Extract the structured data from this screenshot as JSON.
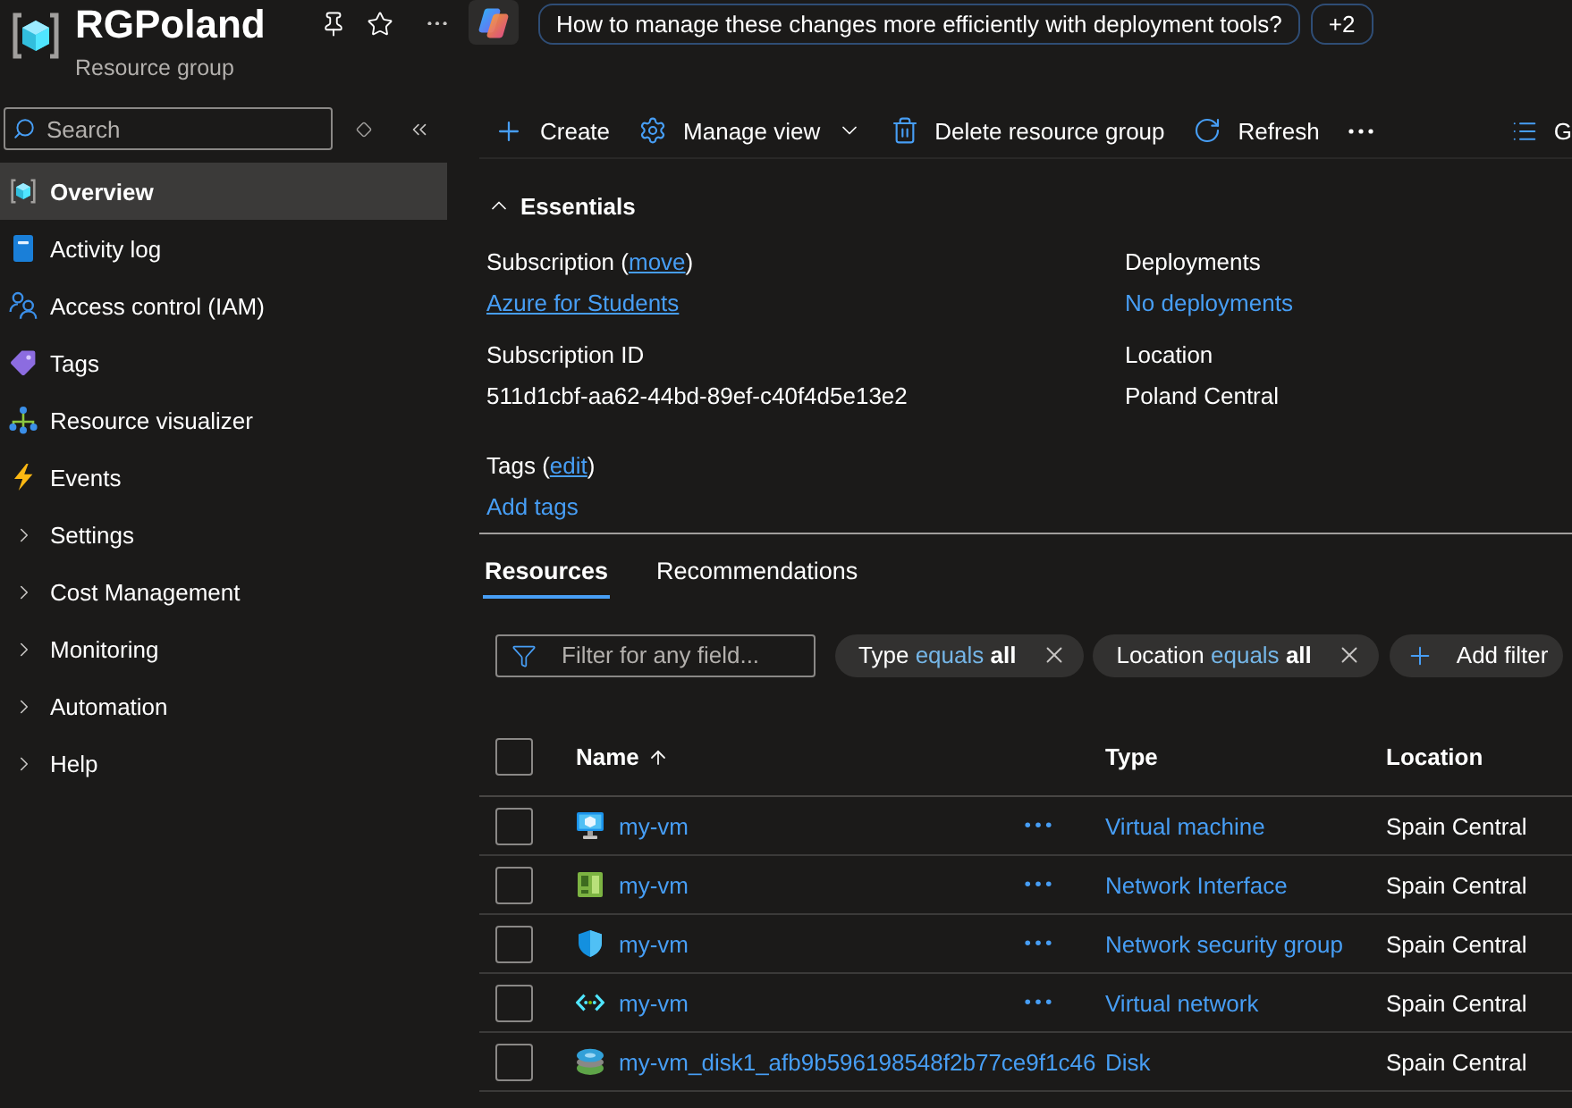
{
  "header": {
    "title": "RGPoland",
    "subtitle": "Resource group",
    "copilot_prompt": "How to manage these changes more efficiently with deployment tools?",
    "more_prompts": "+2"
  },
  "sidebar": {
    "search": {
      "placeholder": "Search"
    },
    "items": [
      {
        "label": "Overview",
        "kind": "page",
        "selected": true
      },
      {
        "label": "Activity log",
        "kind": "page",
        "selected": false
      },
      {
        "label": "Access control (IAM)",
        "kind": "page",
        "selected": false
      },
      {
        "label": "Tags",
        "kind": "page",
        "selected": false
      },
      {
        "label": "Resource visualizer",
        "kind": "page",
        "selected": false
      },
      {
        "label": "Events",
        "kind": "page",
        "selected": false
      },
      {
        "label": "Settings",
        "kind": "group",
        "selected": false,
        "expanded": false
      },
      {
        "label": "Cost Management",
        "kind": "group",
        "selected": false,
        "expanded": false
      },
      {
        "label": "Monitoring",
        "kind": "group",
        "selected": false,
        "expanded": false
      },
      {
        "label": "Automation",
        "kind": "group",
        "selected": false,
        "expanded": false
      },
      {
        "label": "Help",
        "kind": "group",
        "selected": false,
        "expanded": false
      }
    ]
  },
  "toolbar": {
    "items": [
      {
        "kind": "button",
        "label": "Create"
      },
      {
        "kind": "button",
        "label": "Manage view",
        "dropdown": true
      },
      {
        "kind": "button",
        "label": "Delete resource group"
      },
      {
        "kind": "button",
        "label": "Refresh"
      },
      {
        "kind": "more"
      },
      {
        "kind": "button",
        "label": "G"
      }
    ]
  },
  "essentials": {
    "title": "Essentials",
    "expanded": true,
    "columns": [
      [
        {
          "label": "Subscription (",
          "action": "move",
          "label_end": ")",
          "value": "Azure for Students",
          "kind": "underlined_link"
        },
        {
          "label": "Subscription ID",
          "value": "511d1cbf-aa62-44bd-89ef-c40f4d5e13e2",
          "kind": "text"
        }
      ],
      [
        {
          "label": "Deployments",
          "value": "No deployments",
          "kind": "link"
        },
        {
          "label": "Location",
          "value": "Poland Central",
          "kind": "text"
        }
      ]
    ],
    "tags": {
      "label": "Tags (",
      "action": "edit",
      "label_end": ")",
      "value": "Add tags",
      "kind": "link"
    }
  },
  "tabs": [
    {
      "label": "Resources",
      "selected": true
    },
    {
      "label": "Recommendations",
      "selected": false
    }
  ],
  "filters": {
    "search": {
      "placeholder": "Filter for any field..."
    },
    "pills": [
      {
        "field": "Type",
        "operator": "equals",
        "value": "all"
      },
      {
        "field": "Location",
        "operator": "equals",
        "value": "all"
      }
    ],
    "add_label": "Add filter"
  },
  "table": {
    "select_all": {
      "checked": false
    },
    "columns": [
      {
        "label": "Name",
        "sorted_ascending": true
      },
      {
        "label": "Type",
        "sorted_ascending": false
      },
      {
        "label": "Location",
        "sorted_ascending": false
      }
    ],
    "rows": [
      {
        "kind": "virtual_machine",
        "name": "my-vm",
        "type": "Virtual machine",
        "location": "Spain Central",
        "checked": false,
        "actions": true
      },
      {
        "kind": "network_interface",
        "name": "my-vm",
        "type": "Network Interface",
        "location": "Spain Central",
        "checked": false,
        "actions": true
      },
      {
        "kind": "security_group",
        "name": "my-vm",
        "type": "Network security group",
        "location": "Spain Central",
        "checked": false,
        "actions": true
      },
      {
        "kind": "virtual_network",
        "name": "my-vm",
        "type": "Virtual network",
        "location": "Spain Central",
        "checked": false,
        "actions": true
      },
      {
        "kind": "disk",
        "name": "my-vm_disk1_afb9b596198548f2b77ce9f1c46",
        "type": "Disk",
        "location": "Spain Central",
        "checked": false,
        "actions": false
      }
    ]
  }
}
